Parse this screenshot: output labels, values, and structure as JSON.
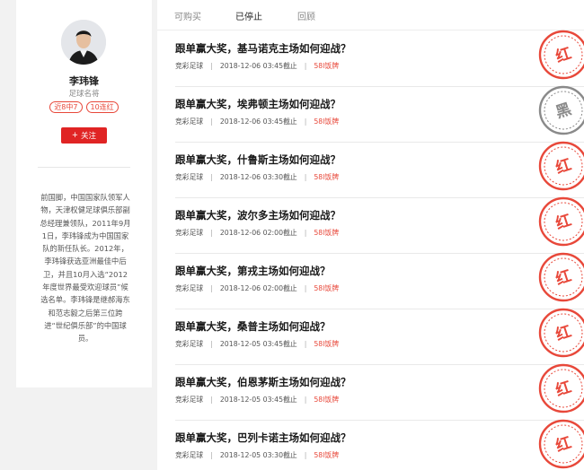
{
  "colors": {
    "accent": "#e02424",
    "badge": "#e8483a"
  },
  "profile": {
    "name": "李玮锋",
    "title": "足球名将",
    "badges": [
      "近8中7",
      "10连红"
    ],
    "follow_label": "关注",
    "bio": "前国脚，中国国家队领军人物，天津权健足球俱乐部副总经理兼领队，2011年9月1日，李玮锋成为中国国家队的新任队长。2012年，李玮锋获选亚洲最佳中后卫，并且10月入选“2012年度世界最受欢迎球员”候选名单。李玮锋是继郝海东和范志毅之后第三位跨进“世纪俱乐部”的中国球员。"
  },
  "tabs": [
    {
      "label": "可购买",
      "active": false
    },
    {
      "label": "已停止",
      "active": true
    },
    {
      "label": "回顾",
      "active": false
    }
  ],
  "articles": [
    {
      "title": "跟单赢大奖，基马诺克主场如何迎战？",
      "category": "竞彩足球",
      "deadline": "2018-12-06 03:45截止",
      "count": "58l饭牌",
      "stamp": "红",
      "result": "red"
    },
    {
      "title": "跟单赢大奖，埃弗顿主场如何迎战？",
      "category": "竞彩足球",
      "deadline": "2018-12-06 03:45截止",
      "count": "58l饭牌",
      "stamp": "黑",
      "result": "black"
    },
    {
      "title": "跟单赢大奖，什鲁斯主场如何迎战？",
      "category": "竞彩足球",
      "deadline": "2018-12-06 03:30截止",
      "count": "58l饭牌",
      "stamp": "红",
      "result": "red"
    },
    {
      "title": "跟单赢大奖，波尔多主场如何迎战？",
      "category": "竞彩足球",
      "deadline": "2018-12-06 02:00截止",
      "count": "58l饭牌",
      "stamp": "红",
      "result": "red"
    },
    {
      "title": "跟单赢大奖，第戎主场如何迎战？",
      "category": "竞彩足球",
      "deadline": "2018-12-06 02:00截止",
      "count": "58l饭牌",
      "stamp": "红",
      "result": "red"
    },
    {
      "title": "跟单赢大奖，桑普主场如何迎战？",
      "category": "竞彩足球",
      "deadline": "2018-12-05 03:45截止",
      "count": "58l饭牌",
      "stamp": "红",
      "result": "red"
    },
    {
      "title": "跟单赢大奖，伯恩茅斯主场如何迎战？",
      "category": "竞彩足球",
      "deadline": "2018-12-05 03:45截止",
      "count": "58l饭牌",
      "stamp": "红",
      "result": "red"
    },
    {
      "title": "跟单赢大奖，巴列卡诺主场如何迎战？",
      "category": "竞彩足球",
      "deadline": "2018-12-05 03:30截止",
      "count": "58l饭牌",
      "stamp": "红",
      "result": "red"
    }
  ]
}
